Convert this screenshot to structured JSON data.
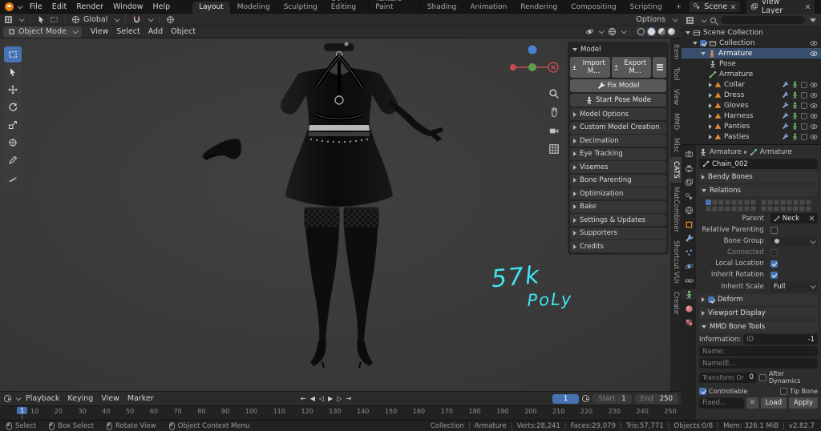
{
  "colors": {
    "accent": "#4772b3",
    "annotation_cyan": "#40e4f0",
    "object_orange": "#e0872f"
  },
  "icons": {
    "search": "css-circle-tail",
    "eye": "svg-eye",
    "dropdown": "css-caret",
    "hamburger": "css-3-lines",
    "close": "css-x",
    "magnet": "svg-magnet",
    "mouse": "css-mouse-shape",
    "wrench": "svg-wrench",
    "person": "svg-person"
  },
  "topbar": {
    "menus": [
      "File",
      "Edit",
      "Render",
      "Window",
      "Help"
    ],
    "workspaces": [
      "Layout",
      "Modeling",
      "Sculpting",
      "UV Editing",
      "Texture Paint",
      "Shading",
      "Animation",
      "Rendering",
      "Compositing",
      "Scripting",
      "+"
    ],
    "scene": "Scene",
    "view_layer": "View Layer"
  },
  "vp_header": {
    "mode": "Object Mode",
    "menus": [
      "View",
      "Select",
      "Add",
      "Object"
    ],
    "orientation": "Global",
    "options": "Options"
  },
  "cats": {
    "model_section": "Model",
    "import": "Import M...",
    "export": "Export M...",
    "fix": "Fix Model",
    "pose": "Start Pose Mode",
    "sections": [
      "Model Options",
      "Custom Model Creation",
      "Decimation",
      "Eye Tracking",
      "Visemes",
      "Bone Parenting",
      "Optimization",
      "Bake",
      "Settings & Updates",
      "Supporters",
      "Credits"
    ]
  },
  "side_tabs": [
    "Item",
    "Tool",
    "View",
    "MMD",
    "Misc",
    "CATS",
    "MatCombiner",
    "Shortcut VUr",
    "Create"
  ],
  "annotation": {
    "line1": "57k",
    "line2": "PoLy"
  },
  "outliner": {
    "scene_collection": "Scene Collection",
    "collection": "Collection",
    "armature_object": "Armature",
    "pose": "Pose",
    "armature_data": "Armature",
    "garments": [
      "Collar",
      "Dress",
      "Gloves",
      "Harness",
      "Panties",
      "Pasties"
    ]
  },
  "props": {
    "breadcrumb_object": "Armature",
    "breadcrumb_data": "Armature",
    "bone_name": "Chain_002",
    "bendy_bones": "Bendy Bones",
    "relations": "Relations",
    "parent_label": "Parent",
    "parent_value": "Neck",
    "relative_parenting": "Relative Parenting",
    "bone_group_label": "Bone Group",
    "connected": "Connected",
    "local_location": "Local Location",
    "inherit_rotation": "Inherit Rotation",
    "inherit_scale_label": "Inherit Scale",
    "inherit_scale_value": "Full",
    "deform": "Deform",
    "viewport_display": "Viewport Display",
    "mmd_bone_tools": "MMD Bone Tools",
    "information_label": "Information:",
    "id_label": "ID",
    "id_value": "-1",
    "name_label": "Name:",
    "name_e_label": "Name(E...",
    "transform_order_label": "Transform Or",
    "transform_order_value": "0",
    "after_dynamics": "After Dynamics",
    "controllable": "Controllable",
    "tip_bone": "Tip Bone",
    "fixed_label": "Fixed...",
    "load_label": "Load",
    "apply_label": "Apply"
  },
  "timeline": {
    "menus": [
      "Playback",
      "Keying",
      "View",
      "Marker"
    ],
    "transport": [
      "⇤",
      "◀",
      "◁",
      "▶",
      "▷",
      "⇥"
    ],
    "current_frame": "1",
    "start_label": "Start",
    "start_value": "1",
    "end_label": "End",
    "end_value": "250",
    "first_tick": "1",
    "ticks": [
      "10",
      "20",
      "30",
      "40",
      "50",
      "60",
      "70",
      "80",
      "90",
      "100",
      "110",
      "120",
      "130",
      "140",
      "150",
      "160",
      "170",
      "180",
      "190",
      "200",
      "210",
      "220",
      "230",
      "240",
      "250"
    ]
  },
  "statusbar": {
    "left": [
      "Select",
      "Box Select",
      "Rotate View",
      "Object Context Menu"
    ],
    "stats": [
      "Collection",
      "Armature",
      "Verts:28,241",
      "Faces:29,079",
      "Tris:57,771",
      "Objects:0/8",
      "Mem: 326.1 MiB",
      "v2.82.7"
    ]
  }
}
